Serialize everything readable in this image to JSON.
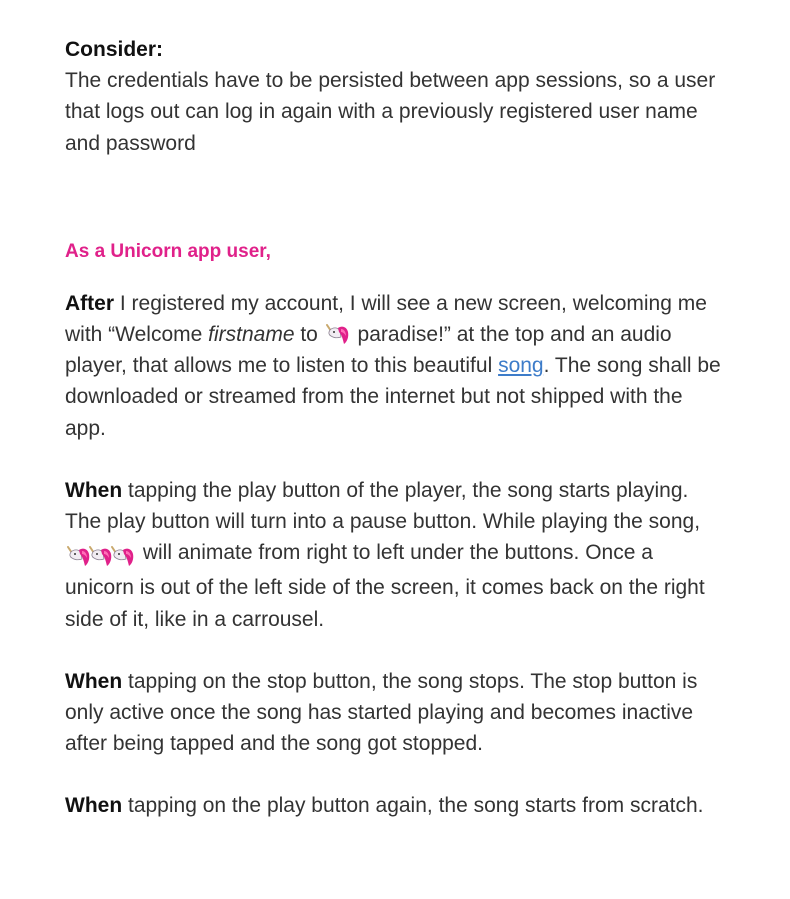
{
  "consider": {
    "heading": "Consider:",
    "text": "The credentials have to be persisted between app sessions, so a user that logs out can log in again with a previously registered user name and password"
  },
  "role": {
    "text": "As a Unicorn app user,"
  },
  "after": {
    "lead": "After",
    "text1": " I registered my account, I will see a new screen, welcoming me with “Welcome ",
    "firstname": "firstname",
    "text2": " to ",
    "text3": " paradise!” at the top and an audio player, that allows me to listen to this beautiful ",
    "link": "song",
    "text4": ". The song shall be downloaded or streamed from the internet but not shipped with the app."
  },
  "when_play": {
    "lead": "When",
    "text1": " tapping the play button of the player, the song starts playing. The play button will turn into a pause button. While playing the song, ",
    "text2": " will animate from right to left under the buttons. Once a unicorn is out of the left side of the screen, it comes back on the right side of it, like in a carrousel."
  },
  "when_stop": {
    "lead": "When",
    "text": " tapping on the stop button, the song stops. The stop button is only active once the song has started playing and becomes inactive after being tapped and the song got stopped."
  },
  "when_again": {
    "lead": "When",
    "text": " tapping on the play button again, the song starts from scratch."
  },
  "colors": {
    "role": "#e0218a",
    "link": "#3d7cc9",
    "body_text": "#333333"
  },
  "icons": {
    "unicorn": "unicorn-icon"
  }
}
